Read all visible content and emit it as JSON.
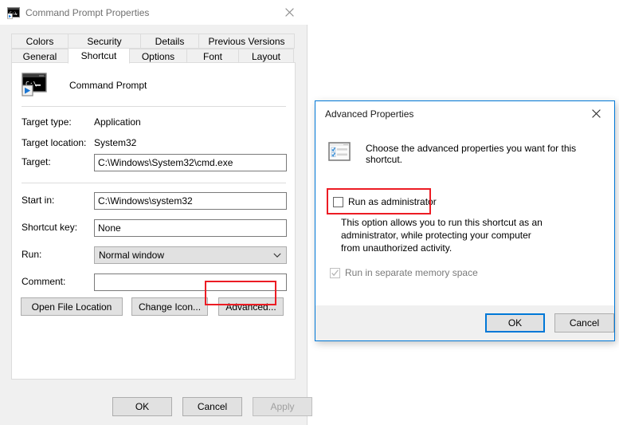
{
  "main_dialog": {
    "title": "Command Prompt Properties",
    "icon": "command-prompt-icon",
    "close_label": "✕",
    "tabs_top": [
      {
        "label": "Colors"
      },
      {
        "label": "Security"
      },
      {
        "label": "Details"
      },
      {
        "label": "Previous Versions"
      }
    ],
    "tabs_bottom": [
      {
        "label": "General"
      },
      {
        "label": "Shortcut"
      },
      {
        "label": "Options"
      },
      {
        "label": "Font"
      },
      {
        "label": "Layout"
      }
    ],
    "selected_tab": "Shortcut",
    "shortcut_panel": {
      "app_name": "Command Prompt",
      "fields": [
        {
          "label": "Target type:",
          "value": "Application",
          "kind": "static"
        },
        {
          "label": "Target location:",
          "value": "System32",
          "kind": "static"
        },
        {
          "label": "Target:",
          "value": "C:\\Windows\\System32\\cmd.exe",
          "kind": "input"
        },
        {
          "label": "Start in:",
          "value": "C:\\Windows\\system32",
          "kind": "input"
        },
        {
          "label": "Shortcut key:",
          "value": "None",
          "kind": "input"
        },
        {
          "label": "Run:",
          "value": "Normal window",
          "kind": "combo"
        },
        {
          "label": "Comment:",
          "value": "",
          "kind": "input"
        }
      ],
      "buttons": [
        {
          "label": "Open File Location"
        },
        {
          "label": "Change Icon..."
        },
        {
          "label": "Advanced...",
          "highlighted": true
        }
      ]
    },
    "footer_buttons": [
      {
        "label": "OK",
        "state": "normal"
      },
      {
        "label": "Cancel",
        "state": "normal"
      },
      {
        "label": "Apply",
        "state": "disabled"
      }
    ]
  },
  "advanced_dialog": {
    "title": "Advanced Properties",
    "close_label": "✕",
    "icon": "properties-checklist-icon",
    "intro": "Choose the advanced properties you want for this shortcut.",
    "run_as_admin": {
      "label": "Run as administrator",
      "checked": false,
      "highlighted": true
    },
    "help_text": "This option allows you to run this shortcut as an administrator, while protecting your computer from unauthorized activity.",
    "separate_memory": {
      "label": "Run in separate memory space",
      "checked": true,
      "disabled": true
    },
    "footer_buttons": [
      {
        "label": "OK",
        "state": "default"
      },
      {
        "label": "Cancel",
        "state": "normal"
      }
    ]
  },
  "colors": {
    "accent": "#0078d7",
    "highlight_red": "#ec1c24",
    "window_bg": "#f0f0f0",
    "panel_bg": "#ffffff",
    "disabled_text": "#a0a0a0"
  }
}
